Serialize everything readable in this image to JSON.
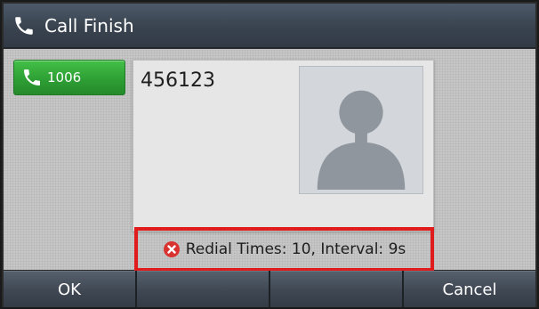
{
  "header": {
    "title": "Call Finish",
    "icon": "phone-handset-icon"
  },
  "line_key": {
    "label": "1006",
    "icon": "phone-handset-icon",
    "color": "#2d9d33"
  },
  "call": {
    "number": "456123",
    "avatar_icon": "contact-silhouette-icon"
  },
  "status": {
    "message": "Redial Times: 10, Interval: 9s",
    "icon": "error-x-icon",
    "highlight_color": "#e01b1b"
  },
  "softkeys": [
    {
      "label": "OK"
    },
    {
      "label": ""
    },
    {
      "label": ""
    },
    {
      "label": "Cancel"
    }
  ]
}
